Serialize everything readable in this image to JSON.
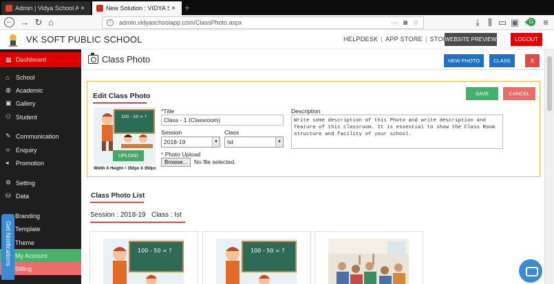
{
  "browser": {
    "tabs": [
      {
        "label": "Admin | Vidya School App | Ja",
        "close": "×"
      },
      {
        "label": "New Solution : VIDYA SCHOOL",
        "close": "×"
      }
    ],
    "new_tab": "+",
    "url_prefix": "admin.vidyaschoolapp.com",
    "url_path": "/ClassPhoto.aspx",
    "url_dots": "···"
  },
  "header": {
    "school_name": "VK SOFT PUBLIC SCHOOL",
    "links": [
      "HELPDESK",
      "APP STORE",
      "STORE"
    ],
    "link_sep": "|",
    "website_preview": "WEBSITE PREVIEW",
    "logout": "LOGOUT"
  },
  "sidebar": {
    "items": [
      {
        "label": "Dashboard",
        "icon": "dashboard-icon"
      },
      {
        "label": "School",
        "icon": "school-icon"
      },
      {
        "label": "Academic",
        "icon": "academic-icon"
      },
      {
        "label": "Gallery",
        "icon": "gallery-icon"
      },
      {
        "label": "Student",
        "icon": "student-icon"
      },
      {
        "label": "Communication",
        "icon": "communication-icon"
      },
      {
        "label": "Enquiry",
        "icon": "enquiry-icon"
      },
      {
        "label": "Promotion",
        "icon": "promotion-icon"
      },
      {
        "label": "Setting",
        "icon": "setting-icon"
      },
      {
        "label": "Data",
        "icon": "data-icon"
      },
      {
        "label": "Branding",
        "icon": ""
      },
      {
        "label": "Template",
        "icon": ""
      },
      {
        "label": "Theme",
        "icon": ""
      },
      {
        "label": "My Account",
        "icon": ""
      },
      {
        "label": "Billing",
        "icon": ""
      }
    ],
    "get_notifications": "Get Notifications"
  },
  "page": {
    "title": "Class Photo",
    "new_photo": "NEW PHOTO",
    "class_button": "CLASS",
    "close_button": "X"
  },
  "edit": {
    "title": "Edit Class Photo",
    "save": "SAVE",
    "cancel": "CANCEL",
    "upload": "UPLOAD",
    "dimensions": "Width X Height = 350px X 350px",
    "title_label": "Title",
    "title_value": "Class - 1 (Classroom)",
    "session_label": "Session",
    "session_value": "2018-19",
    "class_label": "Class",
    "class_value": "Ist",
    "photo_upload_label": "Photo Upload",
    "browse": "Browse...",
    "no_file": "No file selected.",
    "description_label": "Description",
    "description_value": "Write some description of this Photo and write description and feature of this classroom. It is essential to show the Class Room structure and facility of your school.",
    "required_mark": "*"
  },
  "list": {
    "title": "Class Photo List",
    "session_text": "Session : 2018-19",
    "class_text": "Class : Ist"
  },
  "colors": {
    "accent_red": "#e00000",
    "primary_blue": "#1a73c9",
    "save_green": "#3fb36a",
    "cancel_pink": "#f06a6a",
    "edit_border": "#f3b14a"
  }
}
